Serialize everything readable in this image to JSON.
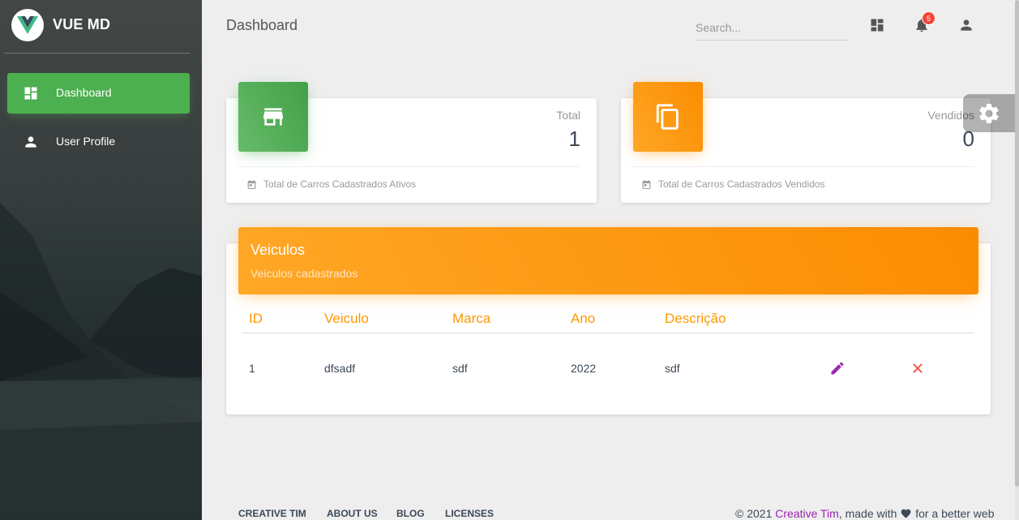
{
  "brand": {
    "name": "VUE MD"
  },
  "sidebar": {
    "items": [
      {
        "label": "Dashboard",
        "icon": "dashboard-icon",
        "active": true
      },
      {
        "label": "User Profile",
        "icon": "person-icon",
        "active": false
      }
    ]
  },
  "header": {
    "title": "Dashboard",
    "search_placeholder": "Search...",
    "notification_count": "5"
  },
  "stats": [
    {
      "category": "Total",
      "value": "1",
      "footer": "Total de Carros Cadastrados Ativos",
      "icon": "store-icon",
      "color": "#4caf50"
    },
    {
      "category": "Vendidos",
      "value": "0",
      "footer": "Total de Carros Cadastrados Vendidos",
      "icon": "copy-icon",
      "color": "#ff9800"
    }
  ],
  "table": {
    "title": "Veiculos",
    "subtitle": "Veiculos cadastrados",
    "columns": [
      "ID",
      "Veiculo",
      "Marca",
      "Ano",
      "Descrição"
    ],
    "rows": [
      {
        "id": "1",
        "veiculo": "dfsadf",
        "marca": "sdf",
        "ano": "2022",
        "descricao": "sdf"
      }
    ]
  },
  "footer": {
    "links": [
      "CREATIVE TIM",
      "ABOUT US",
      "BLOG",
      "LICENSES"
    ],
    "copyright_prefix": "© 2021 ",
    "copyright_brand": "Creative Tim",
    "copyright_mid": ", made with ",
    "copyright_suffix": " for a better web"
  },
  "colors": {
    "accent_green": "#4caf50",
    "accent_orange": "#ff9800",
    "edit": "#9c27b0",
    "delete": "#f44336"
  }
}
